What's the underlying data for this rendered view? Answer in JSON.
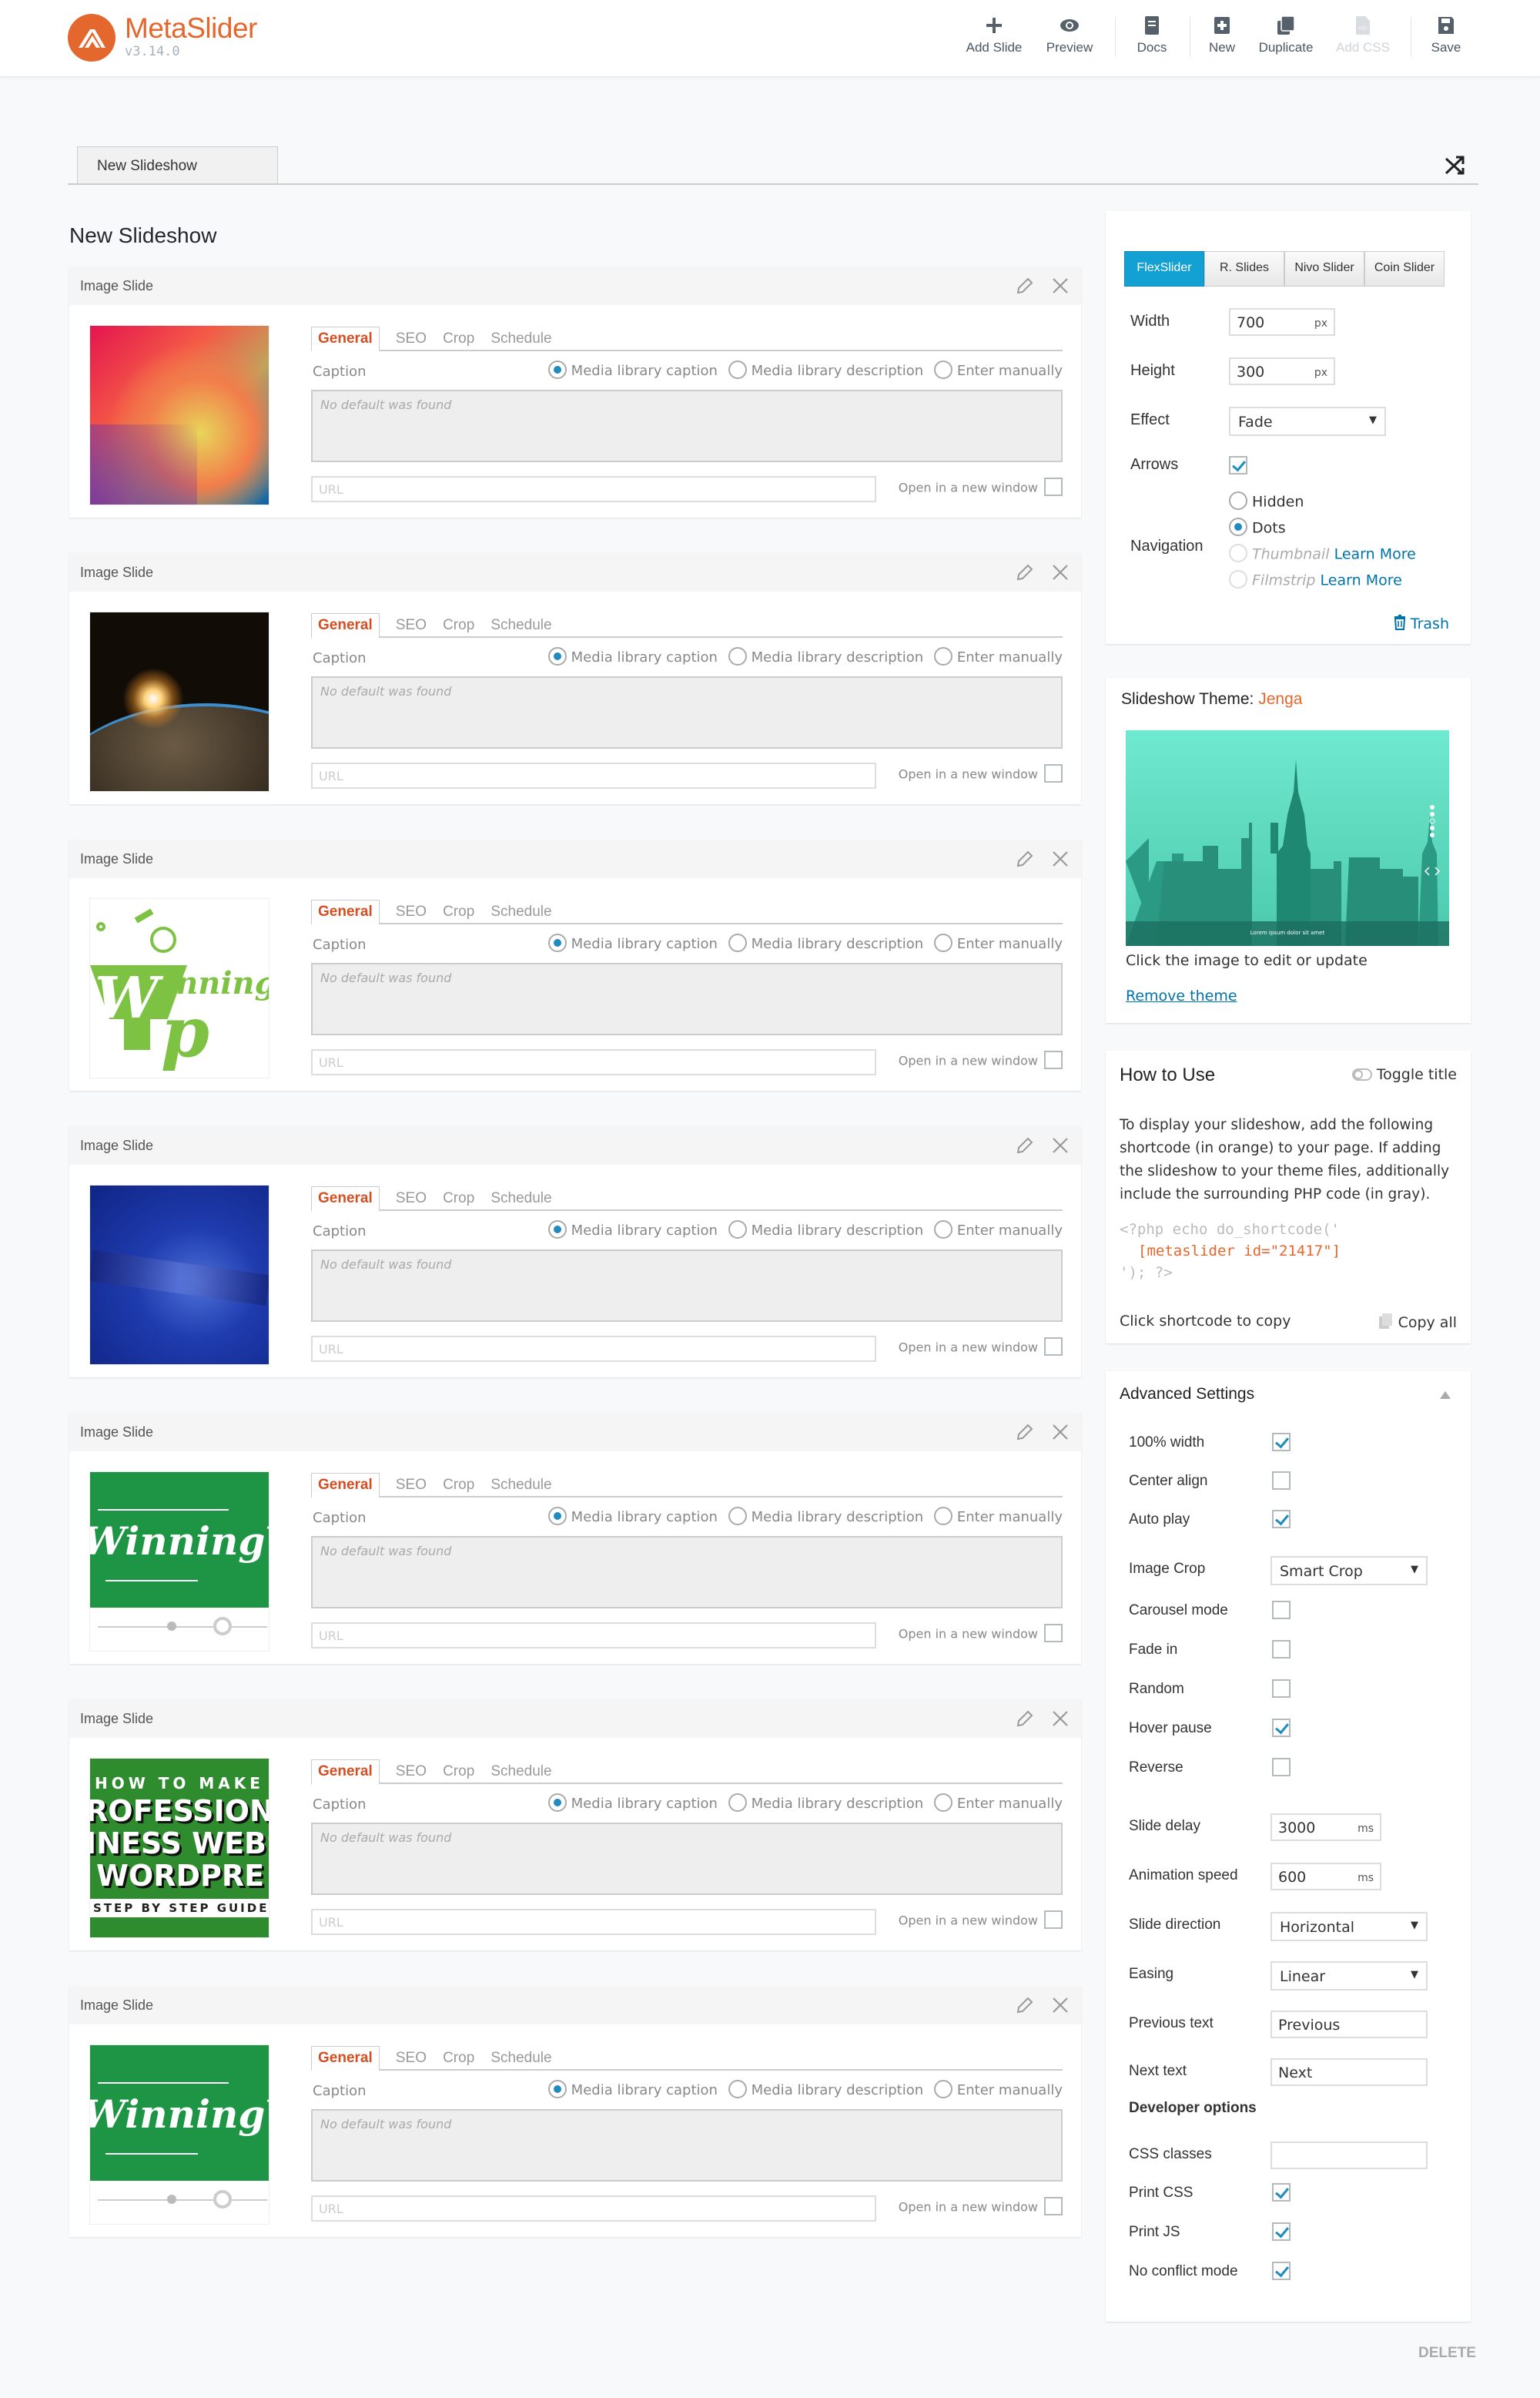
{
  "app": {
    "name": "MetaSlider",
    "version": "v3.14.0",
    "brand_color": "#e4672d",
    "accent_color": "#13a0d2"
  },
  "toolbar": [
    {
      "label": "Add Slide",
      "icon": "plus-icon",
      "disabled": false
    },
    {
      "label": "Preview",
      "icon": "eye-icon",
      "disabled": false
    },
    {
      "label": "Docs",
      "icon": "book-icon",
      "disabled": false
    },
    {
      "label": "New",
      "icon": "plus-square-icon",
      "disabled": false
    },
    {
      "label": "Duplicate",
      "icon": "copy-icon",
      "disabled": false
    },
    {
      "label": "Add CSS",
      "icon": "css-file-icon",
      "disabled": true
    },
    {
      "label": "Save",
      "icon": "floppy-icon",
      "disabled": false
    }
  ],
  "tab": {
    "label": "New Slideshow"
  },
  "page_title": "New Slideshow",
  "slide_common": {
    "header": "Image Slide",
    "tabs": [
      "General",
      "SEO",
      "Crop",
      "Schedule"
    ],
    "active_tab": "General",
    "caption_label": "Caption",
    "caption_options": [
      "Media library caption",
      "Media library description",
      "Enter manually"
    ],
    "caption_selected": "Media library caption",
    "caption_placeholder": "No default was found",
    "url_placeholder": "URL",
    "new_window_label": "Open in a new window"
  },
  "slides": [
    {
      "type": "Image Slide",
      "thumbnail": "rainbow-gradient",
      "new_window": false
    },
    {
      "type": "Image Slide",
      "thumbnail": "earth-sunrise",
      "new_window": false
    },
    {
      "type": "Image Slide",
      "thumbnail": "winning-wp-logo",
      "new_window": false
    },
    {
      "type": "Image Slide",
      "thumbnail": "starry-sky",
      "new_window": false
    },
    {
      "type": "Image Slide",
      "thumbnail": "winning-wp-banner",
      "new_window": false
    },
    {
      "type": "Image Slide",
      "thumbnail": "professional-business-website-guide",
      "new_window": false,
      "thumb_lines": [
        "HOW TO MAKE A",
        "ROFESSIONA",
        "INESS WEBS",
        "WORDPRE",
        "STEP BY STEP GUIDE"
      ]
    },
    {
      "type": "Image Slide",
      "thumbnail": "winning-wp-banner",
      "new_window": false
    }
  ],
  "thumb_text": {
    "winning": "Winning",
    "wp": "Wp",
    "inning": "inning",
    "winningwp": "WinningWP"
  },
  "settings": {
    "slider_types": [
      "FlexSlider",
      "R. Slides",
      "Nivo Slider",
      "Coin Slider"
    ],
    "slider_selected": "FlexSlider",
    "width_label": "Width",
    "width": "700",
    "width_unit": "px",
    "height_label": "Height",
    "height": "300",
    "height_unit": "px",
    "effect_label": "Effect",
    "effect": "Fade",
    "arrows_label": "Arrows",
    "arrows": true,
    "navigation_label": "Navigation",
    "navigation_options": [
      {
        "label": "Hidden",
        "selected": false,
        "disabled": false
      },
      {
        "label": "Dots",
        "selected": true,
        "disabled": false
      },
      {
        "label": "Thumbnail",
        "selected": false,
        "disabled": true,
        "link": "Learn More"
      },
      {
        "label": "Filmstrip",
        "selected": false,
        "disabled": true,
        "link": "Learn More"
      }
    ],
    "trash_label": "Trash"
  },
  "theme": {
    "title": "Slideshow Theme:",
    "name": "Jenga",
    "preview_caption": "Lorem ipsum dolor sit amet",
    "hint": "Click the image to edit or update",
    "remove_label": "Remove theme"
  },
  "how_to_use": {
    "title": "How to Use",
    "toggle_label": "Toggle title",
    "description": "To display your slideshow, add the following shortcode (in orange) to your page. If adding the slideshow to your theme files, additionally include the surrounding PHP code (in gray).",
    "code_pre": "<?php echo do_shortcode('",
    "shortcode": "[metaslider id=\"21417\"]",
    "code_post": "'); ?>",
    "copy_hint": "Click shortcode to copy",
    "copy_all_label": "Copy all"
  },
  "advanced": {
    "title": "Advanced Settings",
    "checkboxes_top": [
      {
        "label": "100% width",
        "checked": true
      },
      {
        "label": "Center align",
        "checked": false
      },
      {
        "label": "Auto play",
        "checked": true
      }
    ],
    "image_crop_label": "Image Crop",
    "image_crop": "Smart Crop",
    "checkboxes_mid": [
      {
        "label": "Carousel mode",
        "checked": false
      },
      {
        "label": "Fade in",
        "checked": false
      },
      {
        "label": "Random",
        "checked": false
      },
      {
        "label": "Hover pause",
        "checked": true
      },
      {
        "label": "Reverse",
        "checked": false
      }
    ],
    "slide_delay_label": "Slide delay",
    "slide_delay": "3000",
    "ms": "ms",
    "animation_speed_label": "Animation speed",
    "animation_speed": "600",
    "slide_direction_label": "Slide direction",
    "slide_direction": "Horizontal",
    "easing_label": "Easing",
    "easing": "Linear",
    "previous_text_label": "Previous text",
    "previous_text": "Previous",
    "next_text_label": "Next text",
    "next_text": "Next",
    "developer_title": "Developer options",
    "css_classes_label": "CSS classes",
    "css_classes": "",
    "checkboxes_dev": [
      {
        "label": "Print CSS",
        "checked": true
      },
      {
        "label": "Print JS",
        "checked": true
      },
      {
        "label": "No conflict mode",
        "checked": true
      }
    ]
  },
  "delete_label": "DELETE"
}
